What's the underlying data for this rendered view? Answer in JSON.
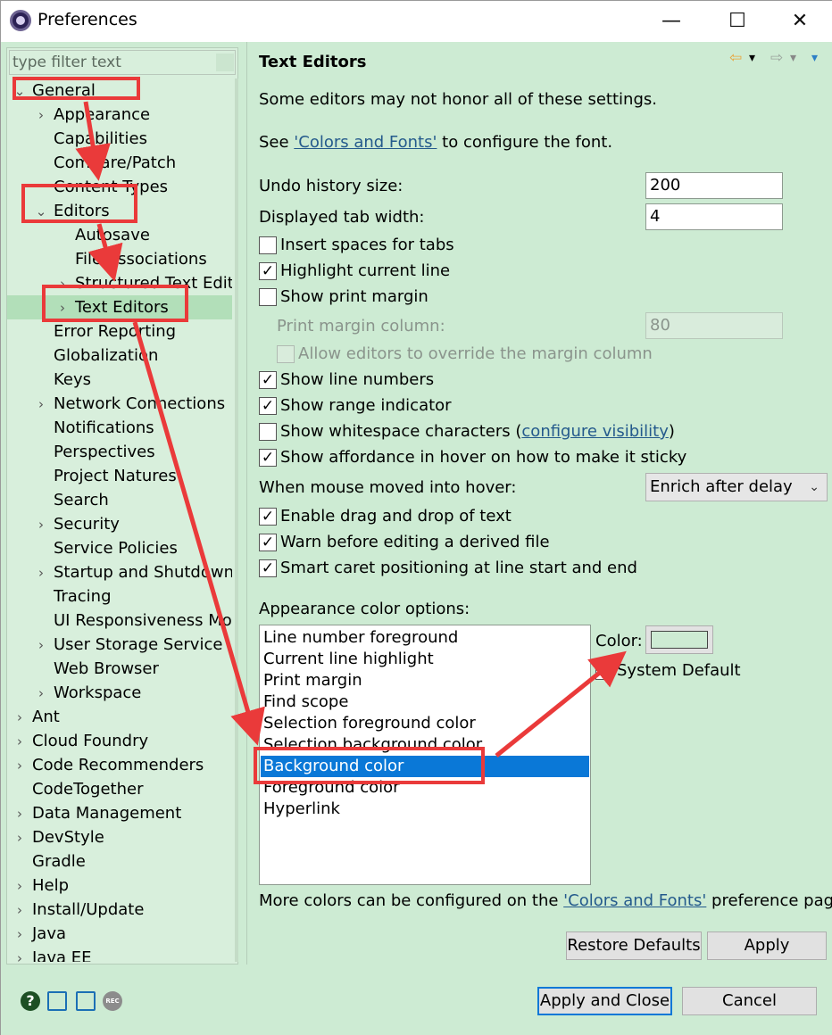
{
  "window": {
    "title": "Preferences",
    "minimize_glyph": "—",
    "maximize_glyph": "☐",
    "close_glyph": "✕"
  },
  "filter": {
    "placeholder": "type filter text"
  },
  "tree": [
    {
      "label": "General",
      "twist": "⌄"
    },
    {
      "label": "Appearance",
      "twist": "›"
    },
    {
      "label": "Capabilities",
      "twist": ""
    },
    {
      "label": "Compare/Patch",
      "twist": ""
    },
    {
      "label": "Content Types",
      "twist": ""
    },
    {
      "label": "Editors",
      "twist": "⌄"
    },
    {
      "label": "Autosave",
      "twist": ""
    },
    {
      "label": "File Associations",
      "twist": ""
    },
    {
      "label": "Structured Text Edito",
      "twist": "›"
    },
    {
      "label": "Text Editors",
      "twist": "›"
    },
    {
      "label": "Error Reporting",
      "twist": ""
    },
    {
      "label": "Globalization",
      "twist": ""
    },
    {
      "label": "Keys",
      "twist": ""
    },
    {
      "label": "Network Connections",
      "twist": "›"
    },
    {
      "label": "Notifications",
      "twist": ""
    },
    {
      "label": "Perspectives",
      "twist": ""
    },
    {
      "label": "Project Natures",
      "twist": ""
    },
    {
      "label": "Search",
      "twist": ""
    },
    {
      "label": "Security",
      "twist": "›"
    },
    {
      "label": "Service Policies",
      "twist": ""
    },
    {
      "label": "Startup and Shutdown",
      "twist": "›"
    },
    {
      "label": "Tracing",
      "twist": ""
    },
    {
      "label": "UI Responsiveness Mor",
      "twist": ""
    },
    {
      "label": "User Storage Service",
      "twist": "›"
    },
    {
      "label": "Web Browser",
      "twist": ""
    },
    {
      "label": "Workspace",
      "twist": "›"
    },
    {
      "label": "Ant",
      "twist": "›"
    },
    {
      "label": "Cloud Foundry",
      "twist": "›"
    },
    {
      "label": "Code Recommenders",
      "twist": "›"
    },
    {
      "label": "CodeTogether",
      "twist": ""
    },
    {
      "label": "Data Management",
      "twist": "›"
    },
    {
      "label": "DevStyle",
      "twist": "›"
    },
    {
      "label": "Gradle",
      "twist": ""
    },
    {
      "label": "Help",
      "twist": "›"
    },
    {
      "label": "Install/Update",
      "twist": "›"
    },
    {
      "label": "Java",
      "twist": "›"
    },
    {
      "label": "Java EE",
      "twist": "›"
    }
  ],
  "page": {
    "title": "Text Editors",
    "nav_back": "⇦",
    "nav_forward": "⇨",
    "nav_dropdown": "▾",
    "note": "Some editors may not honor all of these settings.",
    "font_prefix": "See ",
    "font_link": "'Colors and Fonts'",
    "font_suffix": " to configure the font.",
    "undo_label": "Undo history size:",
    "undo_value": "200",
    "tab_label": "Displayed tab width:",
    "tab_value": "4",
    "insert_spaces": "Insert spaces for tabs",
    "highlight_line": "Highlight current line",
    "show_print_margin": "Show print margin",
    "print_margin_label": "Print margin column:",
    "print_margin_value": "80",
    "allow_override": "Allow editors to override the margin column",
    "show_line_numbers": "Show line numbers",
    "show_range": "Show range indicator",
    "show_whitespace": "Show whitespace characters (",
    "configure_visibility": "configure visibility",
    "close_paren": ")",
    "show_affordance": "Show affordance in hover on how to make it sticky",
    "hover_label": "When mouse moved into hover:",
    "hover_value": "Enrich after delay",
    "drag_drop": "Enable drag and drop of text",
    "warn_derived": "Warn before editing a derived file",
    "smart_caret": "Smart caret positioning at line start and end",
    "appearance_label": "Appearance color options:",
    "color_options": [
      "Line number foreground",
      "Current line highlight",
      "Print margin",
      "Find scope",
      "Selection foreground color",
      "Selection background color",
      "Background color",
      "Foreground color",
      "Hyperlink"
    ],
    "selected_color_option": "Background color",
    "color_label": "Color:",
    "system_default": "System Default",
    "more_prefix": "More colors can be configured on the ",
    "more_link": "'Colors and Fonts'",
    "more_suffix": " preference page.",
    "restore_defaults": "Restore Defaults",
    "apply": "Apply",
    "checked_mark": "✓"
  },
  "footer": {
    "apply_close": "Apply and Close",
    "cancel": "Cancel",
    "help_glyph": "?",
    "rec_glyph": "REC"
  },
  "colors": {
    "background": "#cdebd3",
    "selection": "#0a78d7",
    "annotation": "#ea3a3a",
    "link": "#245a8c"
  }
}
